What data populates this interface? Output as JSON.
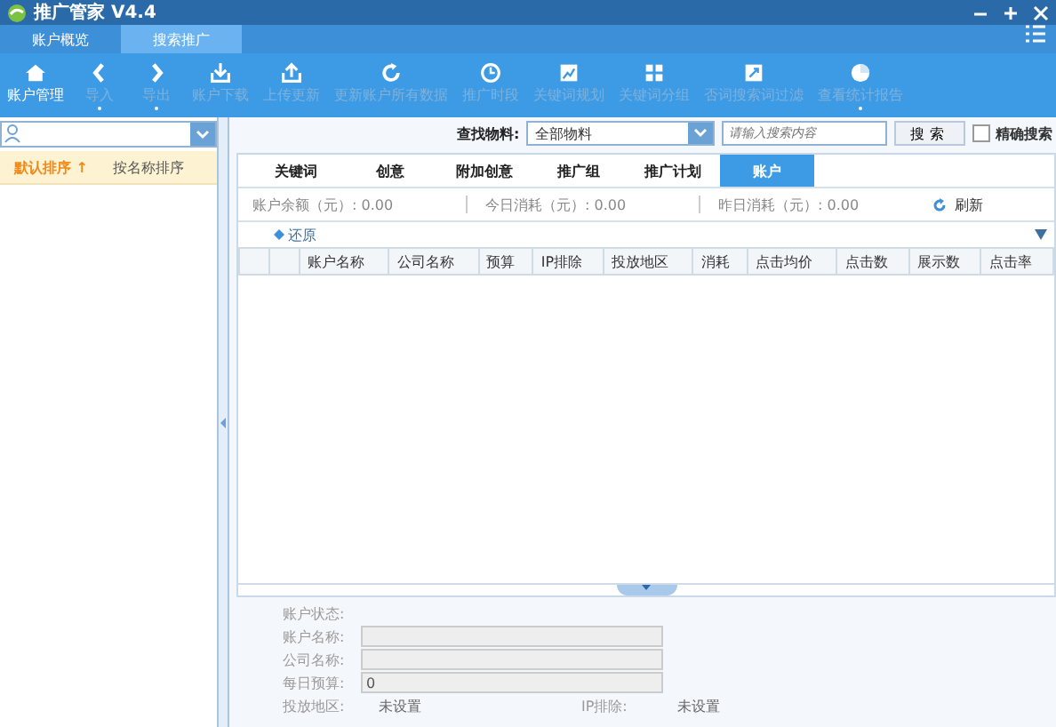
{
  "window": {
    "title": "推广管家 V4.4"
  },
  "top_tabs": [
    {
      "label": "账户概览",
      "selected": false
    },
    {
      "label": "搜索推广",
      "selected": true
    }
  ],
  "toolbar": [
    {
      "label": "账户管理",
      "disabled": false,
      "dropdown": false
    },
    {
      "label": "导入",
      "disabled": true,
      "dropdown": true
    },
    {
      "label": "导出",
      "disabled": true,
      "dropdown": true
    },
    {
      "label": "账户下载",
      "disabled": true,
      "dropdown": false
    },
    {
      "label": "上传更新",
      "disabled": true,
      "dropdown": false
    },
    {
      "label": "更新账户所有数据",
      "disabled": true,
      "dropdown": false
    },
    {
      "label": "推广时段",
      "disabled": true,
      "dropdown": false
    },
    {
      "label": "关键词规划",
      "disabled": true,
      "dropdown": false
    },
    {
      "label": "关键词分组",
      "disabled": true,
      "dropdown": false
    },
    {
      "label": "否词搜索词过滤",
      "disabled": true,
      "dropdown": false
    },
    {
      "label": "查看统计报告",
      "disabled": true,
      "dropdown": true
    }
  ],
  "sidebar": {
    "sort_options": [
      {
        "label": "默认排序 ↑",
        "selected": true
      },
      {
        "label": "按名称排序",
        "selected": false
      }
    ]
  },
  "filter": {
    "label": "查找物料:",
    "select_value": "全部物料",
    "search_placeholder": "请输入搜索内容",
    "search_button": "搜索",
    "exact_label": "精确搜索",
    "exact_checked": false
  },
  "tabs": [
    {
      "label": "关键词",
      "selected": false
    },
    {
      "label": "创意",
      "selected": false
    },
    {
      "label": "附加创意",
      "selected": false
    },
    {
      "label": "推广组",
      "selected": false
    },
    {
      "label": "推广计划",
      "selected": false
    },
    {
      "label": "账户",
      "selected": true
    }
  ],
  "summary": [
    {
      "label": "账户余额（元）:",
      "value": "0.00"
    },
    {
      "label": "今日消耗（元）:",
      "value": "0.00"
    },
    {
      "label": "昨日消耗（元）:",
      "value": "0.00"
    }
  ],
  "refresh_button": "刷新",
  "restore_button": "还原",
  "table": {
    "columns": [
      "账户名称",
      "公司名称",
      "预算",
      "IP排除",
      "投放地区",
      "消耗",
      "点击均价",
      "点击数",
      "展示数",
      "点击率"
    ]
  },
  "details": {
    "status_label": "账户状态:",
    "fields": [
      {
        "label": "账户名称:"
      },
      {
        "label": "公司名称:"
      },
      {
        "label": "每日预算:",
        "value": "0"
      }
    ],
    "bottom": [
      {
        "label": "投放地区:",
        "value": "未设置"
      },
      {
        "label": "IP排除:",
        "value": "未设置"
      }
    ]
  }
}
